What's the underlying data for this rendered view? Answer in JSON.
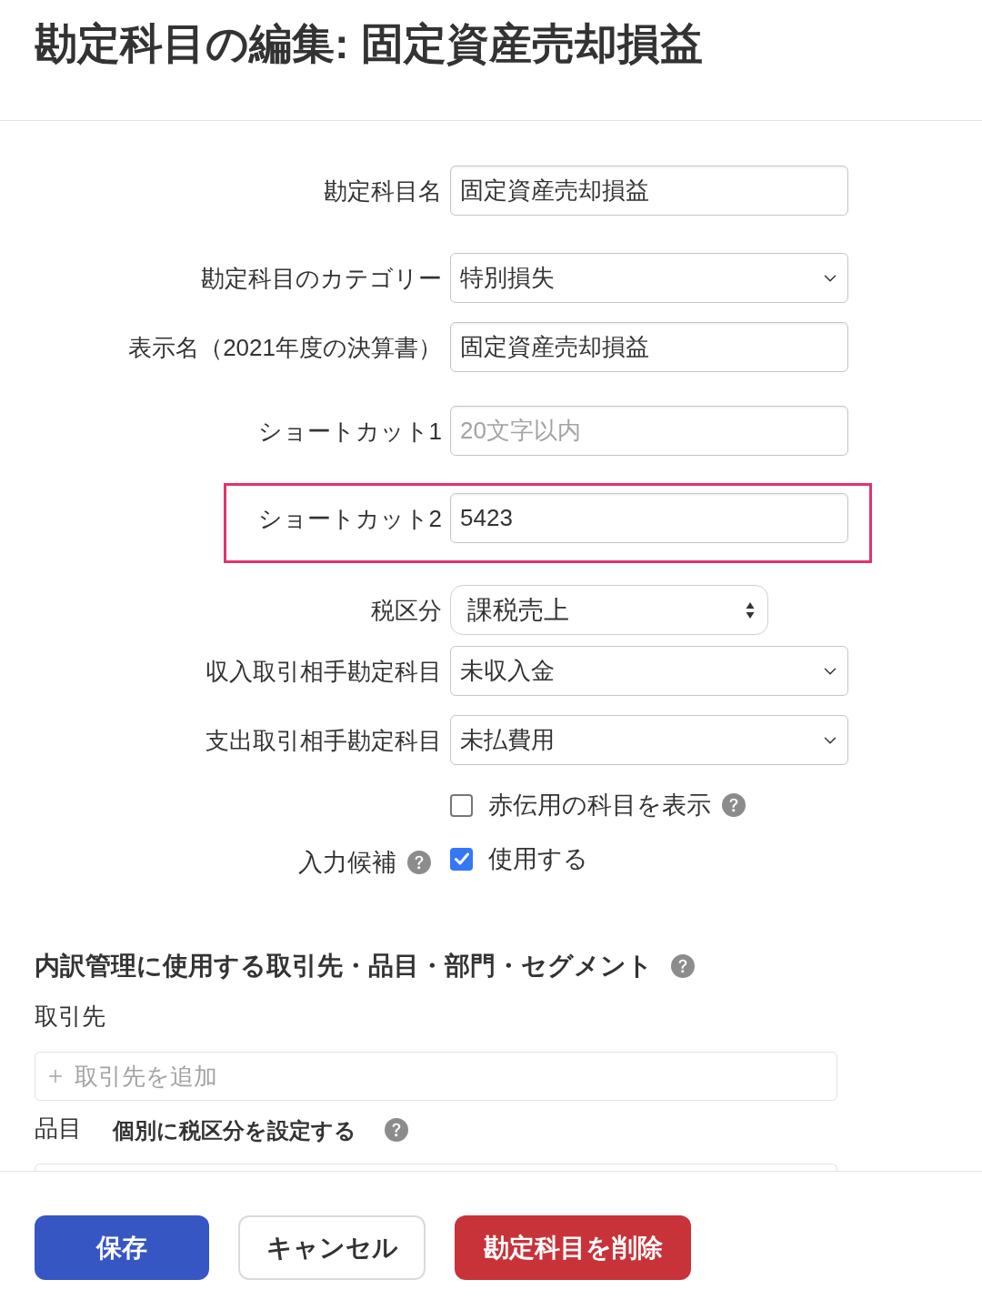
{
  "title": "勘定科目の編集: 固定資産売却損益",
  "fields": [
    {
      "kind": "text",
      "label": "勘定科目名",
      "value": "固定資産売却損益",
      "highlighted": false
    },
    {
      "kind": "select",
      "label": "勘定科目のカテゴリー",
      "value": "特別損失",
      "highlighted": false
    },
    {
      "kind": "text",
      "label": "表示名（2021年度の決算書）",
      "value": "固定資産売却損益",
      "highlighted": false
    },
    {
      "kind": "text",
      "label": "ショートカット1",
      "placeholder": "20文字以内",
      "highlighted": false
    },
    {
      "kind": "text",
      "label": "ショートカット2",
      "value": "5423",
      "highlighted": true
    },
    {
      "kind": "stepper_select",
      "label": "税区分",
      "value": "課税売上",
      "highlighted": false
    },
    {
      "kind": "select",
      "label": "収入取引相手勘定科目",
      "value": "未収入金",
      "highlighted": false
    },
    {
      "kind": "select",
      "label": "支出取引相手勘定科目",
      "value": "未払費用",
      "highlighted": false
    }
  ],
  "options": [
    {
      "text": "赤伝用の科目を表示",
      "checked": false,
      "help": true
    },
    {
      "label": "入力候補",
      "label_help": true,
      "text": "使用する",
      "checked": true
    }
  ],
  "breakdown": {
    "heading": "内訳管理に使用する取引先・品目・部門・セグメント",
    "heading_help": true,
    "partners": {
      "label": "取引先",
      "placeholder": "取引先を追加"
    },
    "items": {
      "label": "品目",
      "setting": "個別に税区分を設定する",
      "setting_help": true
    }
  },
  "buttons": [
    {
      "kind": "primary",
      "label": "保存"
    },
    {
      "kind": "secondary",
      "label": "キャンセル"
    },
    {
      "kind": "danger",
      "label": "勘定科目を削除"
    }
  ]
}
